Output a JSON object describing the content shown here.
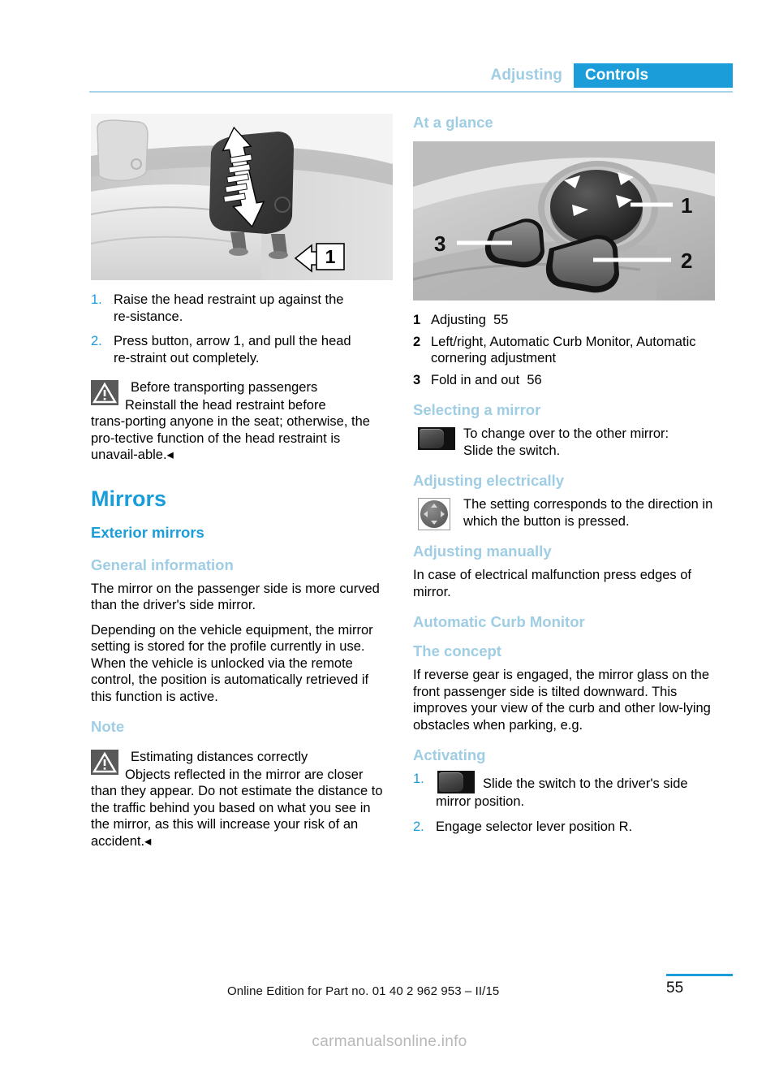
{
  "header": {
    "chapter": "Adjusting",
    "section_tab": "Controls",
    "accent_color": "#1b9dd9",
    "muted_accent_color": "#9fcde4"
  },
  "left_column": {
    "figure_seat": {
      "caption_callout": "1",
      "alt": "Rear seat head restraint with up/down arrow and callout 1"
    },
    "steps": [
      {
        "num": "1.",
        "text": "Raise the head restraint up against the re‑sistance."
      },
      {
        "num": "2.",
        "text": "Press button, arrow 1, and pull the head re‑straint out completely."
      }
    ],
    "warning": {
      "icon": "warning-triangle-icon",
      "title": "Before transporting passengers",
      "text": "Reinstall the head restraint before trans‑porting anyone in the seat; otherwise, the pro‑tective function of the head restraint is unavail‑able.◂"
    },
    "mirrors_heading": "Mirrors",
    "exterior_mirrors_heading": "Exterior mirrors",
    "general_information_heading": "General information",
    "general_paragraph_1": "The mirror on the passenger side is more curved than the driver's side mirror.",
    "general_paragraph_2": "Depending on the vehicle equipment, the mirror setting is stored for the profile currently in use. When the vehicle is unlocked via the remote control, the position is automatically retrieved if this function is active.",
    "note_heading": "Note",
    "note": {
      "icon": "warning-triangle-icon",
      "title": "Estimating distances correctly",
      "text": "Objects reflected in the mirror are closer than they appear. Do not estimate the distance to the traffic behind you based on what you see in the mirror, as this will increase your risk of an accident.◂"
    }
  },
  "right_column": {
    "at_a_glance_heading": "At a glance",
    "figure_controls": {
      "alt": "Door panel mirror controls: round adjustment knob and two buttons",
      "callouts": [
        "1",
        "2",
        "3"
      ]
    },
    "legend": [
      {
        "num": "1",
        "label": "Adjusting",
        "page": "55"
      },
      {
        "num": "2",
        "label": "Left/right, Automatic Curb Monitor, Automatic cornering adjustment",
        "page": ""
      },
      {
        "num": "3",
        "label": "Fold in and out",
        "page": "56"
      }
    ],
    "selecting_heading": "Selecting a mirror",
    "selecting": {
      "icon": "mirror-select-switch-icon",
      "line1": "To change over to the other mirror:",
      "line2": "Slide the switch."
    },
    "adjusting_electrically_heading": "Adjusting electrically",
    "adjusting_electrically": {
      "icon": "direction-pad-knob-icon",
      "text": "The setting corresponds to the direction in which the button is pressed."
    },
    "adjusting_manually_heading": "Adjusting manually",
    "adjusting_manually_text": "In case of electrical malfunction press edges of mirror.",
    "curb_monitor_heading": "Automatic Curb Monitor",
    "concept_heading": "The concept",
    "concept_text": "If reverse gear is engaged, the mirror glass on the front passenger side is tilted downward. This improves your view of the curb and other low-lying obstacles when parking, e.g.",
    "activating_heading": "Activating",
    "activating_steps": [
      {
        "num": "1.",
        "icon": "mirror-select-switch-icon",
        "text": "Slide the switch to the driver's side mirror position."
      },
      {
        "num": "2.",
        "icon": "",
        "text": "Engage selector lever position R."
      }
    ]
  },
  "footer": {
    "edition_text": "Online Edition for Part no. 01 40 2 962 953 – II/15",
    "page_number": "55",
    "watermark": "carmanualsonline.info"
  }
}
